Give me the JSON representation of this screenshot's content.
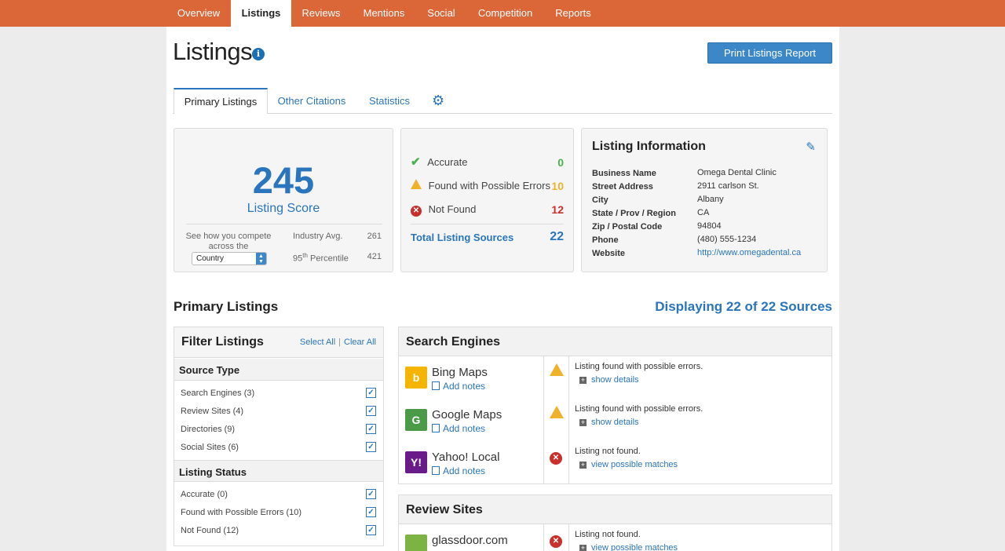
{
  "nav": {
    "items": [
      "Overview",
      "Listings",
      "Reviews",
      "Mentions",
      "Social",
      "Competition",
      "Reports"
    ],
    "active": "Listings"
  },
  "page": {
    "title": "Listings",
    "print_button": "Print Listings Report"
  },
  "tabs": [
    "Primary Listings",
    "Other Citations",
    "Statistics"
  ],
  "score": {
    "value": "245",
    "label": "Listing Score",
    "compete_text": "See how you compete across the",
    "country_select": "Country",
    "industry_avg_label": "Industry Avg.",
    "industry_avg_value": "261",
    "percentile_num": "95",
    "percentile_sup": "th",
    "percentile_word": "Percentile",
    "percentile_value": "421"
  },
  "status": {
    "accurate_label": "Accurate",
    "accurate_count": "0",
    "errors_label": "Found with Possible Errors",
    "errors_count": "10",
    "notfound_label": "Not Found",
    "notfound_count": "12",
    "total_label": "Total Listing Sources",
    "total_count": "22",
    "colors": {
      "accurate": "#4caf50",
      "errors": "#f0b22b",
      "notfound": "#c9302c",
      "total": "#2a75bb"
    }
  },
  "listing_info": {
    "title": "Listing Information",
    "fields": [
      {
        "key": "Business Name",
        "value": "Omega Dental Clinic"
      },
      {
        "key": "Street Address",
        "value": "2911 carlson St."
      },
      {
        "key": "City",
        "value": "Albany"
      },
      {
        "key": "State / Prov / Region",
        "value": "CA"
      },
      {
        "key": "Zip / Postal Code",
        "value": "94804"
      },
      {
        "key": "Phone",
        "value": "(480) 555-1234"
      },
      {
        "key": "Website",
        "value": "http://www.omegadental.ca"
      }
    ]
  },
  "primary": {
    "title": "Primary Listings",
    "displaying": "Displaying 22 of 22 Sources"
  },
  "filter": {
    "title": "Filter Listings",
    "select_all": "Select All",
    "clear_all": "Clear All",
    "source_type_title": "Source Type",
    "source_types": [
      "Search Engines (3)",
      "Review Sites (4)",
      "Directories (9)",
      "Social Sites (6)"
    ],
    "status_title": "Listing Status",
    "statuses": [
      "Accurate (0)",
      "Found with Possible Errors (10)",
      "Not Found (12)"
    ]
  },
  "results": {
    "search_engines_title": "Search Engines",
    "review_sites_title": "Review Sites",
    "add_notes": "Add notes",
    "rows": [
      {
        "name": "Bing Maps",
        "icon": "warning-icon",
        "message": "Listing found with possible errors.",
        "link": "show details"
      },
      {
        "name": "Google Maps",
        "icon": "warning-icon",
        "message": "Listing found with possible errors.",
        "link": "show details"
      },
      {
        "name": "Yahoo! Local",
        "icon": "error-icon",
        "message": "Listing not found.",
        "link": "view possible matches"
      },
      {
        "name": "glassdoor.com",
        "icon": "error-icon",
        "message": "Listing not found.",
        "link": "view possible matches"
      }
    ]
  }
}
